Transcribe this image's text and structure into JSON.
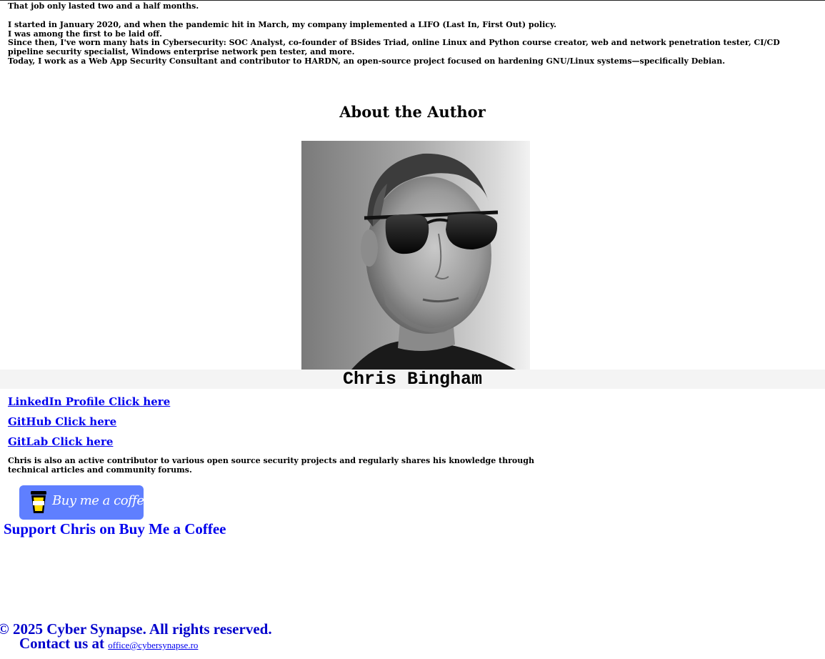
{
  "story": {
    "line_1": "That job only lasted two and a half months.",
    "line_2": "I started in January 2020, and when the pandemic hit in March, my company implemented a LIFO (Last In, First Out) policy.",
    "line_3": "I was among the first to be laid off.",
    "line_4": "Since then, I've worn many hats in Cybersecurity: SOC Analyst, co-founder of BSides Triad, online Linux and Python course creator, web and network penetration tester, CI/CD",
    "line_5": "pipeline security specialist, Windows enterprise network pen tester, and more.",
    "line_6": "Today, I work as a Web App Security Consultant and contributor to HARDN, an open-source project focused on hardening GNU/Linux systems—specifically Debian."
  },
  "about": {
    "heading": "About the Author",
    "name": "Chris Bingham",
    "links": {
      "linkedin": "LinkedIn Profile Click here",
      "github": "GitHub Click here",
      "gitlab": "GitLab Click here"
    },
    "bio": "Chris is also an active contributor to various open source security projects and regularly shares his knowledge through technical articles and community forums."
  },
  "support": {
    "button_label": "Buy me a coffee",
    "link_text": "Support Chris on Buy Me a Coffee",
    "button_color": "#5f7fff"
  },
  "footer": {
    "copyright": "© 2025 Cyber Synapse. All rights reserved.",
    "contact_prefix": "Contact us at",
    "contact_email": "office@cybersynapse.ro"
  },
  "colors": {
    "link": "#0000ee",
    "footer_text": "#0000cc",
    "name_bar_bg": "#f4f4f4"
  },
  "icons": {
    "coffee": "coffee-cup-icon"
  }
}
